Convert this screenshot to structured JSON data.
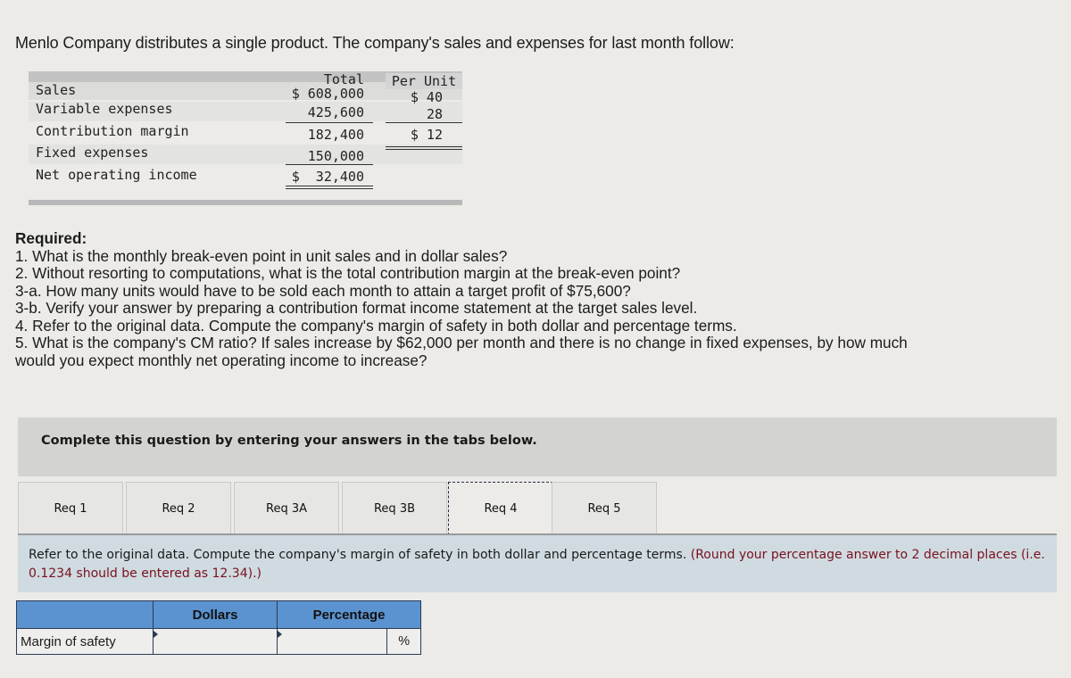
{
  "intro": "Menlo Company distributes a single product. The company's sales and expenses for last month follow:",
  "financial_table": {
    "headers": {
      "total": "Total",
      "per_unit": "Per Unit"
    },
    "rows": [
      {
        "label": "Sales",
        "total": "$ 608,000",
        "per_unit": "$ 40"
      },
      {
        "label": "Variable expenses",
        "total": "425,600",
        "per_unit": "28"
      },
      {
        "label": "Contribution margin",
        "total": "182,400",
        "per_unit": "$ 12"
      },
      {
        "label": "Fixed expenses",
        "total": "150,000",
        "per_unit": ""
      },
      {
        "label": "Net operating income",
        "total": "$  32,400",
        "per_unit": ""
      }
    ]
  },
  "required": {
    "title": "Required:",
    "items": [
      "1. What is the monthly break-even point in unit sales and in dollar sales?",
      "2. Without resorting to computations, what is the total contribution margin at the break-even point?",
      "3-a. How many units would have to be sold each month to attain a target profit of $75,600?",
      "3-b. Verify your answer by preparing a contribution format income statement at the target sales level.",
      "4. Refer to the original data. Compute the company's margin of safety in both dollar and percentage terms.",
      "5. What is the company's CM ratio? If sales increase by $62,000 per month and there is no change in fixed expenses, by how much",
      "would you expect monthly net operating income to increase?"
    ]
  },
  "banner": "Complete this question by entering your answers in the tabs below.",
  "tabs": [
    {
      "label": "Req 1",
      "active": false
    },
    {
      "label": "Req 2",
      "active": false
    },
    {
      "label": "Req 3A",
      "active": false
    },
    {
      "label": "Req 3B",
      "active": false
    },
    {
      "label": "Req 4",
      "active": true
    },
    {
      "label": "Req 5",
      "active": false
    }
  ],
  "instructions": {
    "text": "Refer to the original data. Compute the company's margin of safety in both dollar and percentage terms.",
    "note": "(Round your percentage answer to 2 decimal places (i.e. 0.1234 should be entered as 12.34).)"
  },
  "answer_table": {
    "headers": [
      "",
      "Dollars",
      "Percentage"
    ],
    "row_label": "Margin of safety",
    "dollars_value": "",
    "percentage_value": "",
    "percent_sign": "%"
  }
}
